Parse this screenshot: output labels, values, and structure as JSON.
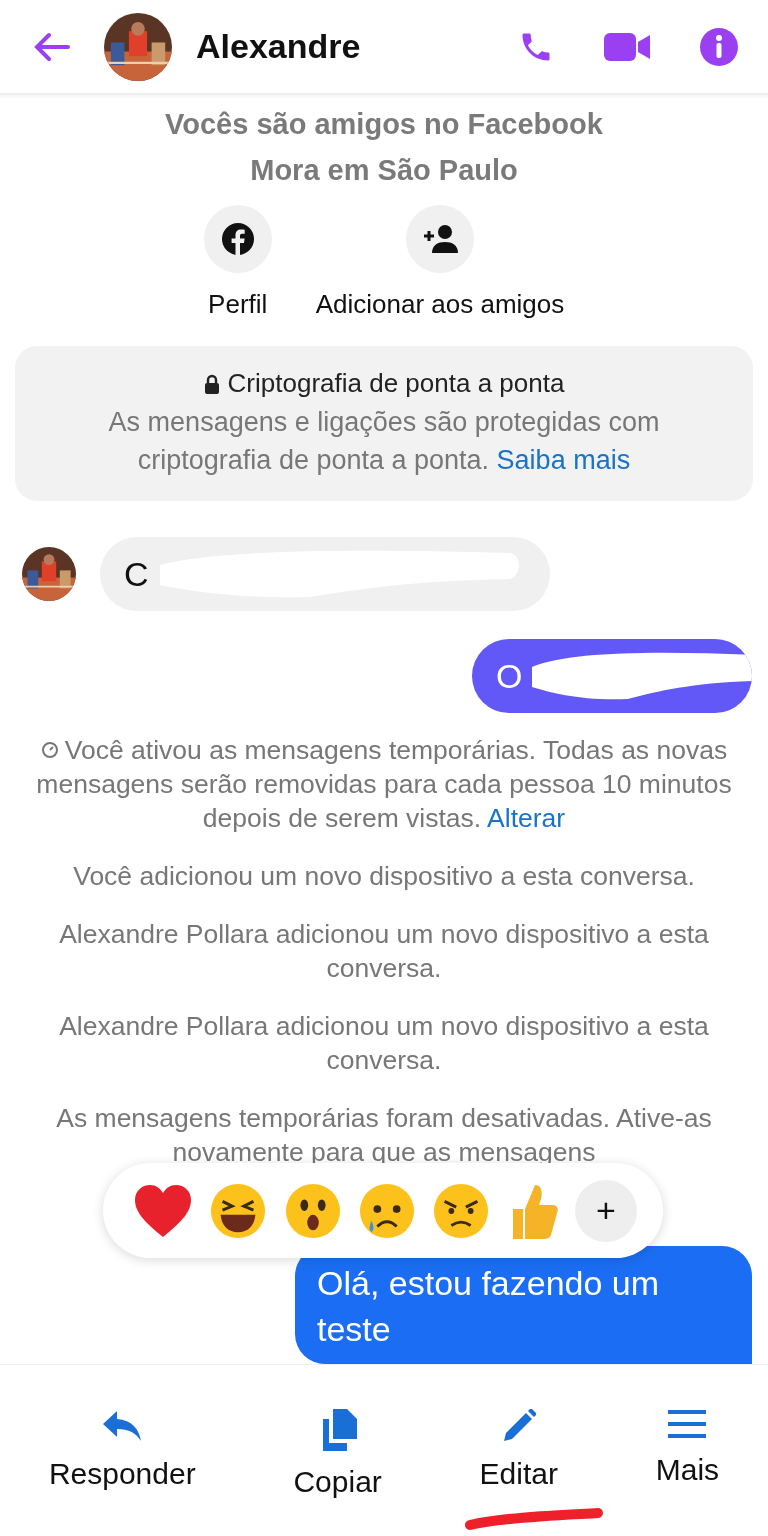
{
  "header": {
    "title": "Alexandre"
  },
  "profile": {
    "lines": [
      "Vocês são amigos no Facebook",
      "Mora em São Paulo"
    ],
    "actions": [
      {
        "kind": "facebook",
        "label": "Perfil"
      },
      {
        "kind": "add-friend",
        "label": "Adicionar aos amigos"
      }
    ]
  },
  "encryption": {
    "title": "Criptografia de ponta a ponta",
    "text": "As mensagens e ligações são protegidas com criptografia de ponta a ponta.",
    "link": "Saiba mais"
  },
  "messages": [
    {
      "kind": "received",
      "text": "C"
    },
    {
      "kind": "sent",
      "text": "O"
    }
  ],
  "notices": [
    {
      "text": "Você ativou as mensagens temporárias. Todas as novas mensagens serão removidas para cada pessoa 10 minutos depois de serem vistas.",
      "link": "Alterar",
      "timer": true
    },
    {
      "text": "Você adicionou um novo dispositivo a esta conversa.",
      "timer": false
    },
    {
      "text": "Alexandre Pollara adicionou um novo dispositivo a esta conversa.",
      "timer": false
    },
    {
      "text": "Alexandre Pollara adicionou um novo dispositivo a esta conversa.",
      "timer": false
    },
    {
      "text": "As mensagens temporárias foram desativadas. Ative-as novamente para que as mensagens",
      "timer": false
    }
  ],
  "reactions": {
    "emojis": [
      {
        "kind": "heart"
      },
      {
        "kind": "laugh"
      },
      {
        "kind": "wow"
      },
      {
        "kind": "sad"
      },
      {
        "kind": "angry"
      },
      {
        "kind": "like"
      }
    ],
    "more": "+"
  },
  "outgoing": {
    "text": "Olá, estou fazendo um teste"
  },
  "actions": [
    {
      "kind": "reply",
      "label": "Responder",
      "underlined": false
    },
    {
      "kind": "copy",
      "label": "Copiar",
      "underlined": false
    },
    {
      "kind": "edit",
      "label": "Editar",
      "underlined": true
    },
    {
      "kind": "more",
      "label": "Mais",
      "underlined": false
    }
  ]
}
